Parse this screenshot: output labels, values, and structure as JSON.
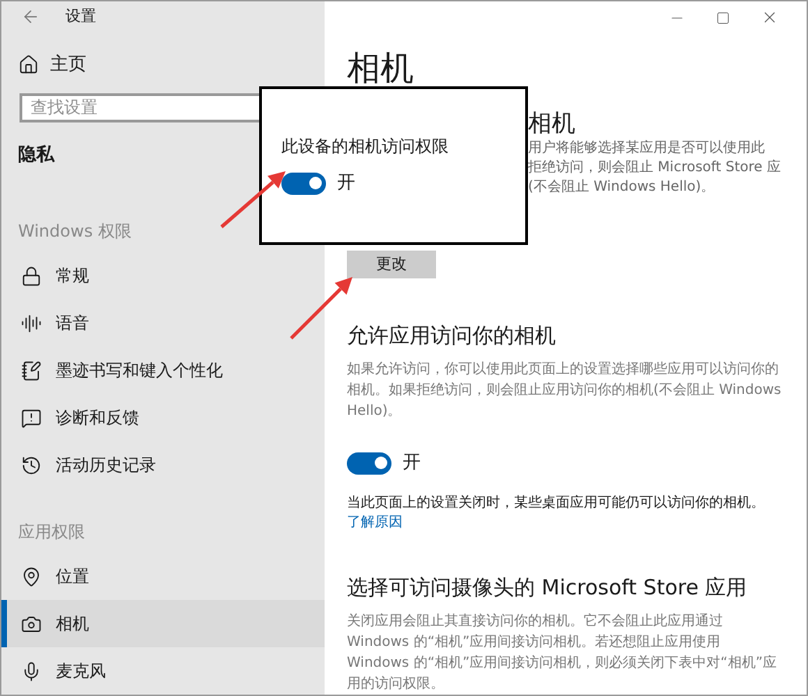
{
  "window": {
    "title": "设置"
  },
  "sidebar": {
    "home": "主页",
    "search": {
      "placeholder": "查找设置"
    },
    "category": "隐私",
    "groups": [
      {
        "heading": "Windows 权限",
        "items": [
          {
            "label": "常规",
            "selected": false
          },
          {
            "label": "语音",
            "selected": false
          },
          {
            "label": "墨迹书写和键入个性化",
            "selected": false
          },
          {
            "label": "诊断和反馈",
            "selected": false
          },
          {
            "label": "活动历史记录",
            "selected": false
          }
        ]
      },
      {
        "heading": "应用权限",
        "items": [
          {
            "label": "位置",
            "selected": false
          },
          {
            "label": "相机",
            "selected": true
          },
          {
            "label": "麦克风",
            "selected": false
          }
        ]
      }
    ]
  },
  "main": {
    "title": "相机",
    "device_section": {
      "heading_fragment": "相机",
      "text_fragments": [
        "用户将能够选择某应用是否可以使用此",
        "拒绝访问，则会阻止 Microsoft Store 应",
        "(不会阻止 Windows Hello)。"
      ],
      "button": "更改"
    },
    "popup": {
      "label": "此设备的相机访问权限",
      "toggle": {
        "on": true,
        "label": "开"
      }
    },
    "apps_section": {
      "heading": "允许应用访问你的相机",
      "description": "如果允许访问，你可以使用此页面上的设置选择哪些应用可以访问你的相机。如果拒绝访问，则会阻止应用访问你的相机(不会阻止 Windows Hello)。",
      "toggle": {
        "on": true,
        "label": "开"
      },
      "note": "当此页面上的设置关闭时，某些桌面应用可能仍可以访问你的相机。",
      "link": "了解原因"
    },
    "store_section": {
      "heading": "选择可访问摄像头的 Microsoft Store 应用",
      "description": "关闭应用会阻止其直接访问你的相机。它不会阻止此应用通过 Windows 的“相机”应用间接访问相机。若还想阻止应用使用 Windows 的“相机”应用间接访问相机，则必须关闭下表中对“相机”应用的访问权限。"
    }
  }
}
